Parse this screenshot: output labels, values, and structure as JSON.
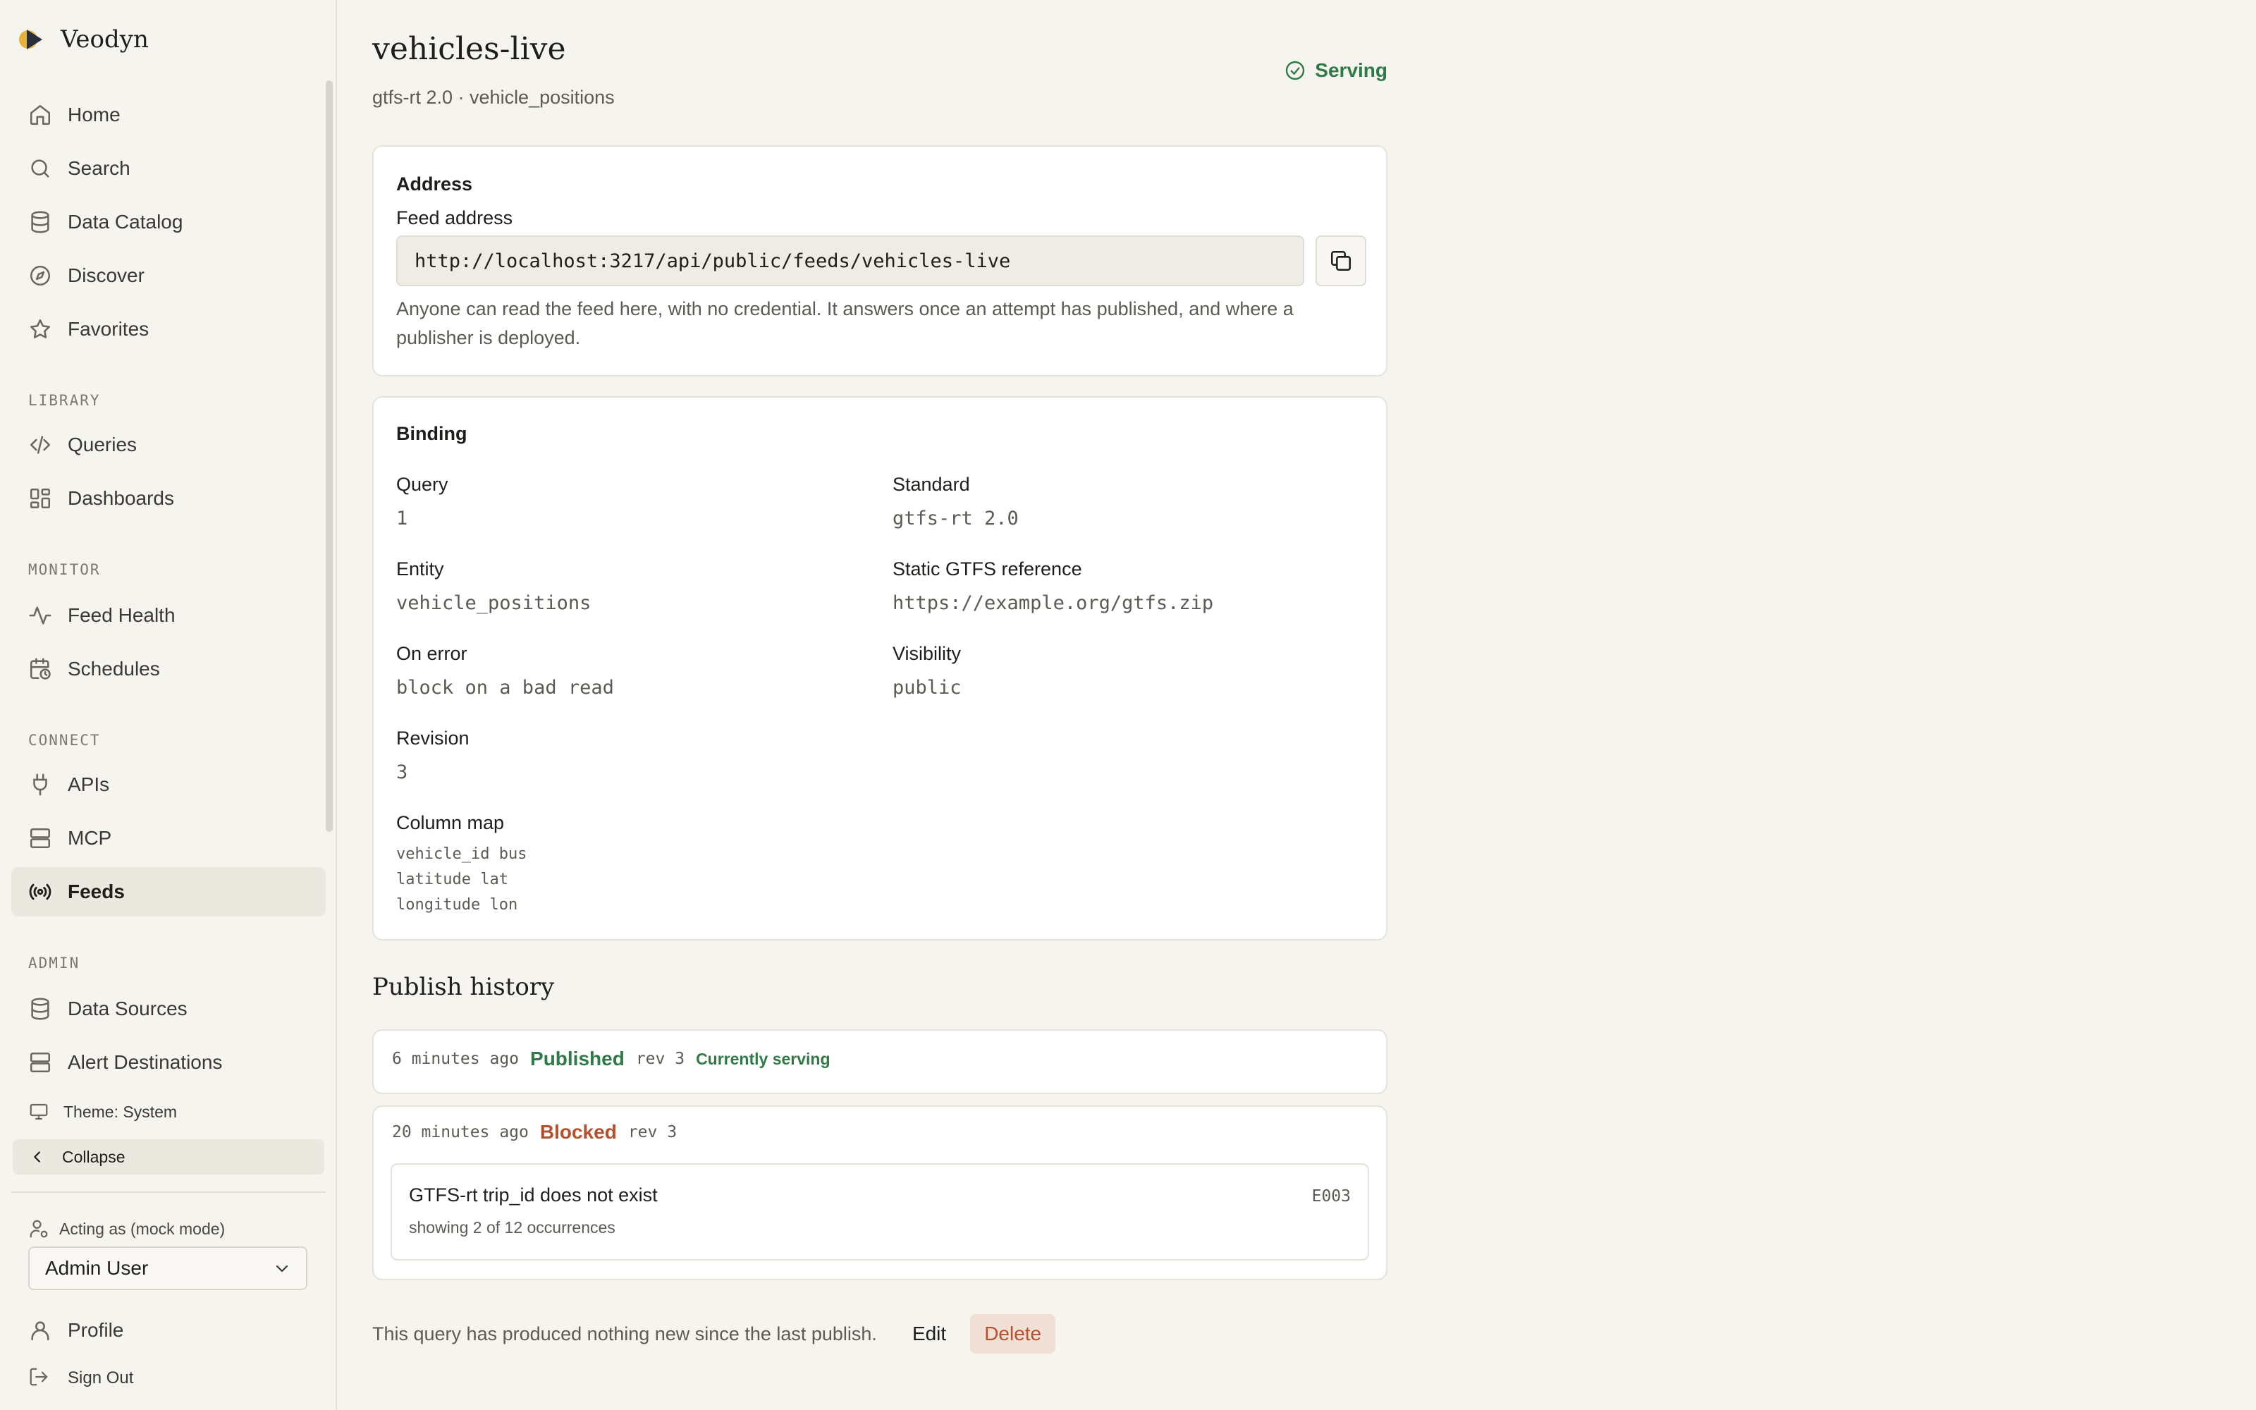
{
  "app": {
    "name": "Veodyn"
  },
  "sidebar": {
    "nav_main": [
      {
        "label": "Home",
        "icon": "home-icon"
      },
      {
        "label": "Search",
        "icon": "search-icon"
      },
      {
        "label": "Data Catalog",
        "icon": "database-icon"
      },
      {
        "label": "Discover",
        "icon": "compass-icon"
      },
      {
        "label": "Favorites",
        "icon": "star-icon"
      }
    ],
    "sections": {
      "library": "LIBRARY",
      "monitor": "MONITOR",
      "connect": "CONNECT",
      "admin": "ADMIN"
    },
    "library_items": [
      {
        "label": "Queries",
        "icon": "code-icon"
      },
      {
        "label": "Dashboards",
        "icon": "dashboard-icon"
      }
    ],
    "monitor_items": [
      {
        "label": "Feed Health",
        "icon": "activity-icon"
      },
      {
        "label": "Schedules",
        "icon": "calendar-clock-icon"
      }
    ],
    "connect_items": [
      {
        "label": "APIs",
        "icon": "plug-icon"
      },
      {
        "label": "MCP",
        "icon": "server-icon"
      },
      {
        "label": "Feeds",
        "icon": "radio-icon",
        "active": true
      }
    ],
    "admin_items": [
      {
        "label": "Data Sources",
        "icon": "database-icon"
      },
      {
        "label": "Alert Destinations",
        "icon": "server-icon"
      }
    ],
    "theme_label": "Theme: System",
    "collapse_label": "Collapse",
    "acting_label": "Acting as (mock mode)",
    "user_select_value": "Admin User",
    "profile_label": "Profile",
    "signout_label": "Sign Out"
  },
  "feed": {
    "title": "vehicles-live",
    "subtitle": "gtfs-rt 2.0 · vehicle_positions",
    "status": "Serving",
    "status_color": "#2f7a46"
  },
  "address": {
    "heading": "Address",
    "field_label": "Feed address",
    "url": "http://localhost:3217/api/public/feeds/vehicles-live",
    "help_line1": "Anyone can read the feed here, with no credential. It answers once an attempt has published, and where a",
    "help_line2": "publisher is deployed."
  },
  "binding": {
    "heading": "Binding",
    "query_label": "Query",
    "query_value": "1",
    "standard_label": "Standard",
    "standard_value": "gtfs-rt 2.0",
    "entity_label": "Entity",
    "entity_value": "vehicle_positions",
    "static_label": "Static GTFS reference",
    "static_value": "https://example.org/gtfs.zip",
    "onerror_label": "On error",
    "onerror_value": "block on a bad read",
    "visibility_label": "Visibility",
    "visibility_value": "public",
    "revision_label": "Revision",
    "revision_value": "3",
    "colmap_label": "Column map",
    "colmap": [
      "vehicle_id bus",
      "latitude lat",
      "longitude lon"
    ]
  },
  "history": {
    "heading": "Publish history",
    "entries": [
      {
        "time": "6 minutes ago",
        "status": "Published",
        "rev": "rev 3",
        "badge": "Currently serving",
        "color": "#2f7a46"
      },
      {
        "time": "20 minutes ago",
        "status": "Blocked",
        "rev": "rev 3",
        "color": "#b5502c"
      }
    ],
    "issue": {
      "title": "GTFS-rt trip_id does not exist",
      "code": "E003",
      "detail": "showing 2 of 12 occurrences"
    }
  },
  "footer": {
    "note": "This query has produced nothing new since the last publish.",
    "edit_label": "Edit",
    "delete_label": "Delete"
  }
}
